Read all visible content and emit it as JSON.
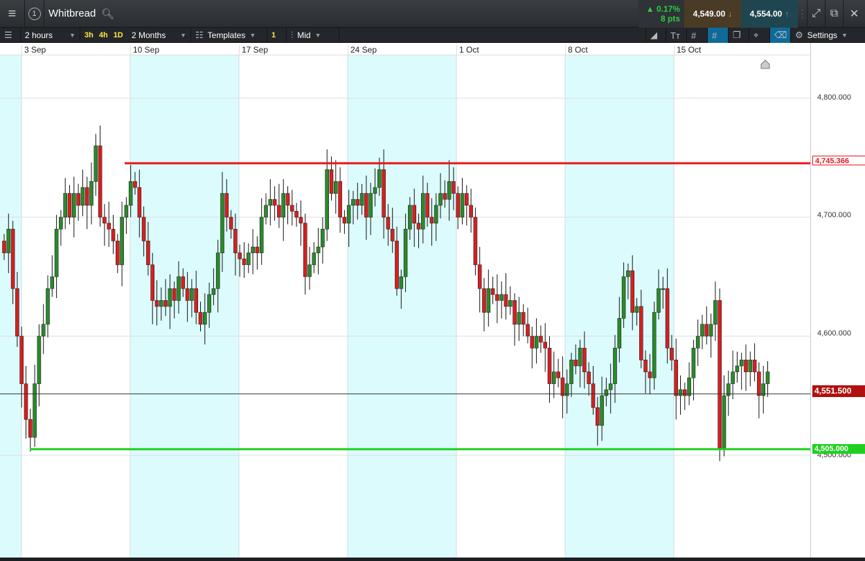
{
  "header": {
    "title": "Whitbread",
    "menu_icon": "hamburger-icon",
    "count": "1",
    "change_pct": "▲ 0.17%",
    "change_pts": "8 pts",
    "bid": "4,549.00",
    "ask": "4,554.00"
  },
  "toolbar": {
    "interval": "2 hours",
    "quick": [
      "3h",
      "4h",
      "1D"
    ],
    "range": "2 Months",
    "templates": "Templates",
    "template_count": "1",
    "price_type": "Mid",
    "settings": "Settings"
  },
  "colors": {
    "up": "#2a8a2a",
    "down": "#d81f1f",
    "resistance": "#e8141c",
    "support": "#1fd11f",
    "shade": "#dcfbfd"
  },
  "chart_data": {
    "type": "candlestick",
    "x_labels": [
      "3 Sep",
      "10 Sep",
      "17 Sep",
      "24 Sep",
      "1 Oct",
      "8 Oct",
      "15 Oct"
    ],
    "y_ticks": [
      "4,800.000",
      "4,700.000",
      "4,600.000",
      "4,500.000"
    ],
    "y_tick_values": [
      4800,
      4700,
      4600,
      4500
    ],
    "ylim": [
      4400,
      4840
    ],
    "lines": {
      "resistance": {
        "value": 4745.366,
        "label": "4,745.366"
      },
      "support": {
        "value": 4505.0,
        "label": "4,505.000"
      },
      "last": {
        "value": 4551.5,
        "label": "4,551.500"
      }
    },
    "closes": [
      4670,
      4690,
      4640,
      4600,
      4560,
      4530,
      4515,
      4560,
      4600,
      4610,
      4640,
      4650,
      4690,
      4700,
      4720,
      4700,
      4720,
      4710,
      4725,
      4710,
      4730,
      4760,
      4700,
      4695,
      4690,
      4680,
      4660,
      4700,
      4710,
      4730,
      4725,
      4700,
      4680,
      4660,
      4630,
      4625,
      4630,
      4625,
      4640,
      4630,
      4650,
      4640,
      4630,
      4640,
      4620,
      4610,
      4620,
      4635,
      4640,
      4670,
      4720,
      4700,
      4690,
      4670,
      4665,
      4660,
      4670,
      4675,
      4670,
      4700,
      4710,
      4715,
      4710,
      4700,
      4720,
      4710,
      4705,
      4700,
      4695,
      4650,
      4660,
      4670,
      4675,
      4690,
      4740,
      4720,
      4730,
      4700,
      4695,
      4710,
      4715,
      4710,
      4720,
      4700,
      4720,
      4725,
      4740,
      4700,
      4690,
      4680,
      4640,
      4650,
      4690,
      4710,
      4695,
      4690,
      4720,
      4700,
      4695,
      4710,
      4720,
      4715,
      4730,
      4720,
      4700,
      4720,
      4710,
      4700,
      4660,
      4640,
      4620,
      4640,
      4635,
      4630,
      4635,
      4625,
      4630,
      4610,
      4620,
      4610,
      4600,
      4590,
      4600,
      4595,
      4590,
      4560,
      4570,
      4565,
      4550,
      4560,
      4580,
      4575,
      4590,
      4570,
      4560,
      4540,
      4525,
      4550,
      4555,
      4560,
      4590,
      4615,
      4650,
      4655,
      4620,
      4625,
      4580,
      4570,
      4565,
      4620,
      4640,
      4640,
      4590,
      4580,
      4550,
      4555,
      4550,
      4565,
      4590,
      4600,
      4610,
      4600,
      4610,
      4630,
      4505,
      4550,
      4560,
      4570,
      4575,
      4580,
      4570,
      4580,
      4570,
      4550,
      4560,
      4570
    ]
  }
}
